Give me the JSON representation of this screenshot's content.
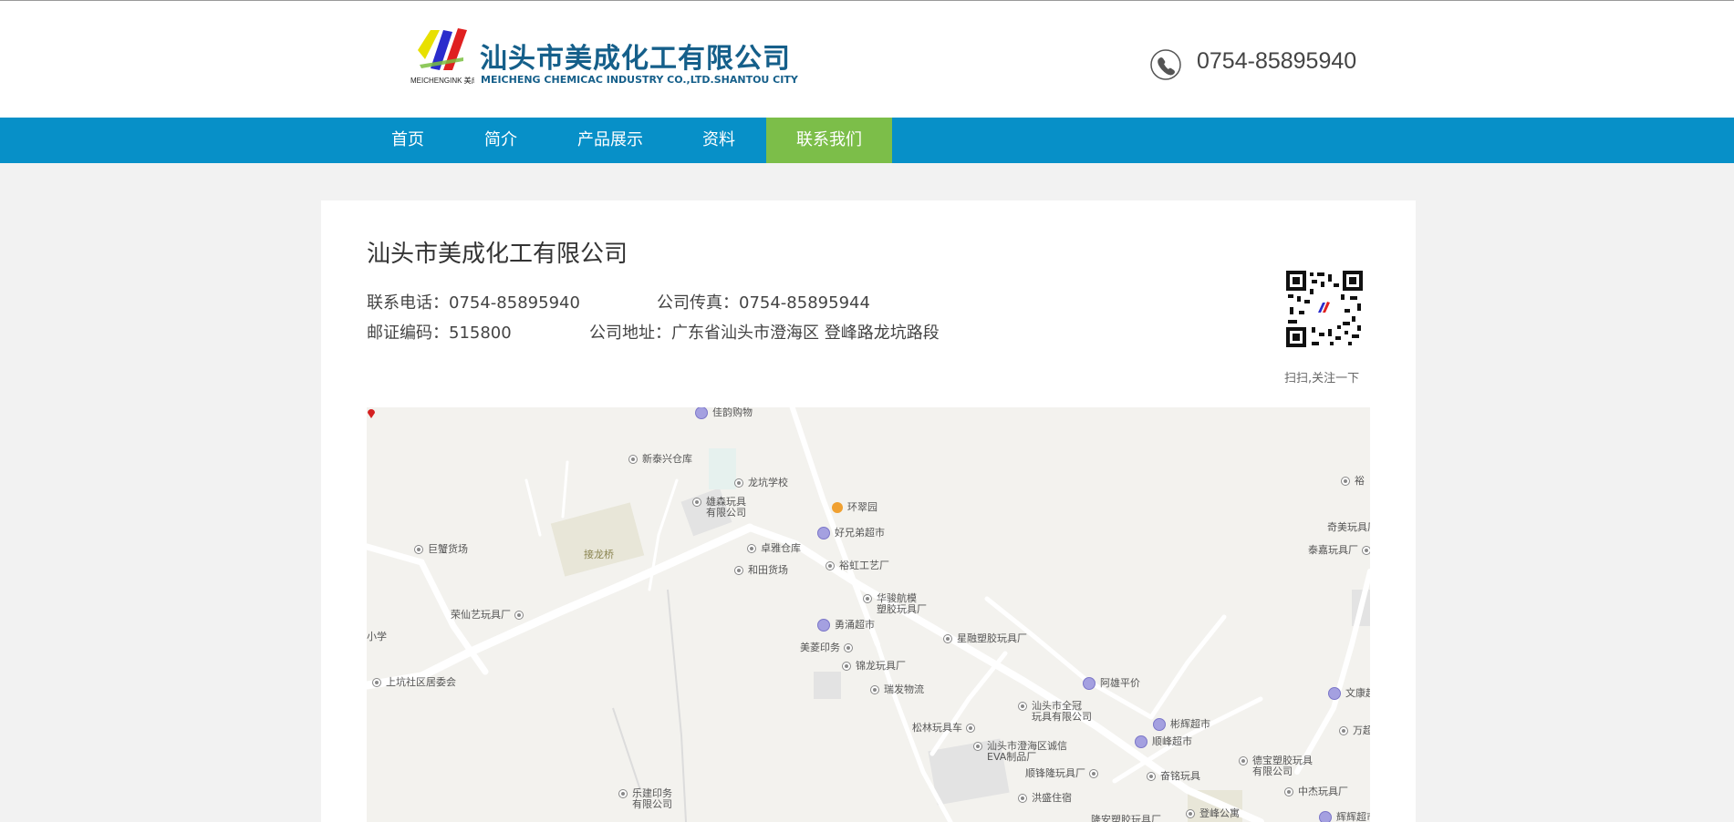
{
  "header": {
    "logo_text": "MEICHENGINK 美成油墨",
    "company_name_cn": "汕头市美成化工有限公司",
    "company_name_en": "MEICHENG CHEMICAC INDUSTRY CO.,LTD.SHANTOU CITY",
    "phone": "0754-85895940"
  },
  "nav": {
    "items": [
      {
        "label": "首页"
      },
      {
        "label": "简介"
      },
      {
        "label": "产品展示"
      },
      {
        "label": "资料"
      },
      {
        "label": "联系我们"
      }
    ],
    "active_index": 4
  },
  "contact": {
    "title": "汕头市美成化工有限公司",
    "phone": "联系电话：0754-85895940",
    "fax": "公司传真：0754-85895944",
    "postcode": "邮证编码：515800",
    "address": "公司地址：广东省汕头市澄海区 登峰路龙坑路段",
    "qr_caption": "扫扫,关注一下"
  },
  "map": {
    "pois": [
      "佳韵购物",
      "新泰兴仓库",
      "龙坑学校",
      "雄森玩具",
      "有限公司",
      "环翠园",
      "好兄弟超市",
      "卓雅仓库",
      "和田货场",
      "裕虹工艺厂",
      "华骏航模",
      "塑胶玩具厂",
      "勇涌超市",
      "美菱印务",
      "锦龙玩具厂",
      "瑞发物流",
      "星融塑胶玩具厂",
      "阿雄平价",
      "汕头市全冠",
      "玩具有限公司",
      "松林玩具车",
      "彬辉超市",
      "顺峰超市",
      "汕头市澄海区诚信",
      "EVA制品厂",
      "顺锋隆玩具厂",
      "奋铭玩具",
      "德宝塑胶玩具",
      "有限公司",
      "中杰玩具厂",
      "洪盛住宿",
      "登峰公寓",
      "辉辉超市",
      "巨蟹货场",
      "荣仙艺玩具厂",
      "上坑社区居委会",
      "乐建印务",
      "有限公司",
      "裕",
      "奇美玩具厂",
      "泰嘉玩具厂",
      "文康超",
      "万超",
      "小学",
      "接龙桥",
      "隆安塑胶玩具厂"
    ]
  },
  "colors": {
    "nav_bg": "#0790c8",
    "nav_active": "#7cbe49",
    "brand": "#155f8a"
  }
}
